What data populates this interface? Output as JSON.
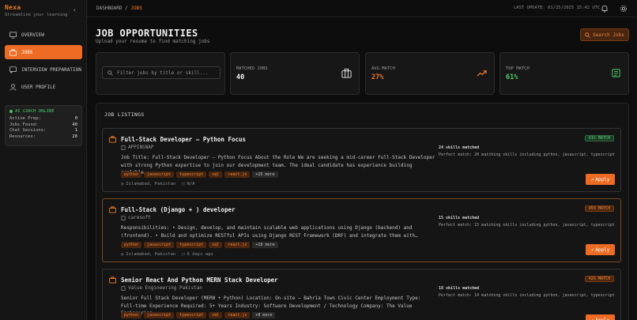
{
  "brand": {
    "name": "Nexa",
    "tagline": "Streamline your learning"
  },
  "nav": {
    "items": [
      {
        "label": "OVERVIEW",
        "icon": "monitor-icon",
        "active": false
      },
      {
        "label": "JOBS",
        "icon": "briefcase-icon",
        "active": true
      },
      {
        "label": "INTERVIEW PREPARATION",
        "icon": "chat-icon",
        "active": false
      },
      {
        "label": "USER PROFILE",
        "icon": "user-icon",
        "active": false
      }
    ]
  },
  "coach": {
    "title": "AI COACH ONLINE",
    "rows": [
      {
        "label": "Active Prep:",
        "value": "0"
      },
      {
        "label": "Jobs Found:",
        "value": "40"
      },
      {
        "label": "Chat Sessions:",
        "value": "1"
      },
      {
        "label": "Resources:",
        "value": "20"
      }
    ]
  },
  "topbar": {
    "breadcrumb_root": "DASHBOARD",
    "breadcrumb_sep": "/",
    "breadcrumb_current": "JOBS",
    "last_update": "LAST UPDATE: 01/25/2025 15:42 UTC"
  },
  "page": {
    "title": "JOB OPPORTUNITIES",
    "subtitle": "Upload your resume to find matching jobs",
    "search_button": "Search Jobs"
  },
  "filter": {
    "placeholder": "Filter jobs by title or skill..."
  },
  "stats": {
    "matched_label": "MATCHED JOBS",
    "matched_value": "40",
    "avg_label": "AVG MATCH",
    "avg_value": "27%",
    "top_label": "TOP MATCH",
    "top_value": "61%"
  },
  "listings": {
    "title": "JOB LISTINGS",
    "apply_label": "Apply",
    "jobs": [
      {
        "title": "Full-Stack Developer – Python Focus",
        "company": "APPINSNAP",
        "match": "61% MATCH",
        "desc": "Job Title: Full-Stack Developer – Python Focus About the Role We are seeking a mid-career Full-Stack Developer with strong Python expertise to join our development team. The ideal candidate has experience building scalable…",
        "tags": [
          "python",
          "javascript",
          "typescript",
          "sql",
          "react.js"
        ],
        "more": "+15 more",
        "location": "Islamabad, Pakistan",
        "posted": "N/A",
        "skills_count": "24 skills matched",
        "skills_detail": "Perfect match: 20 matching skills including python, javascript, typescript"
      },
      {
        "title": "Full-Stack (Django + ) developer",
        "company": "caresoft",
        "match": "45% MATCH",
        "desc": "Responsibilities: • Design, develop, and maintain scalable web applications using Django (backend) and (frontend). • Build and optimize RESTful APIs using Django REST Framework (DRF) and integrate them with…",
        "tags": [
          "python",
          "javascript",
          "typescript",
          "sql",
          "react.js"
        ],
        "more": "+10 more",
        "location": "Islamabad, Pakistan",
        "posted": "6 days ago",
        "skills_count": "15 skills matched",
        "skills_detail": "Perfect match: 15 matching skills including python, javascript, typescript"
      },
      {
        "title": "Senior React And Python MERN Stack Developer",
        "company": "Value Engineering Pakistan",
        "match": "42% MATCH",
        "desc": "Senior Full Stack Developer (MERN + Python) Location: On-site – Bahria Town Civic Center Employment Type: Full-time Experience Required: 5+ Years Industry: Software Development / Technology Company: The Value Engineering…",
        "tags": [
          "python",
          "javascript",
          "typescript",
          "sql",
          "react.js"
        ],
        "more": "+8 more",
        "location": "",
        "posted": "",
        "skills_count": "18 skills matched",
        "skills_detail": "Perfect match: 14 matching skills including python, javascript, typescript"
      }
    ]
  },
  "colors": {
    "accent": "#ee6b24",
    "green": "#4fcf6d",
    "bg": "#0d0d0d"
  }
}
